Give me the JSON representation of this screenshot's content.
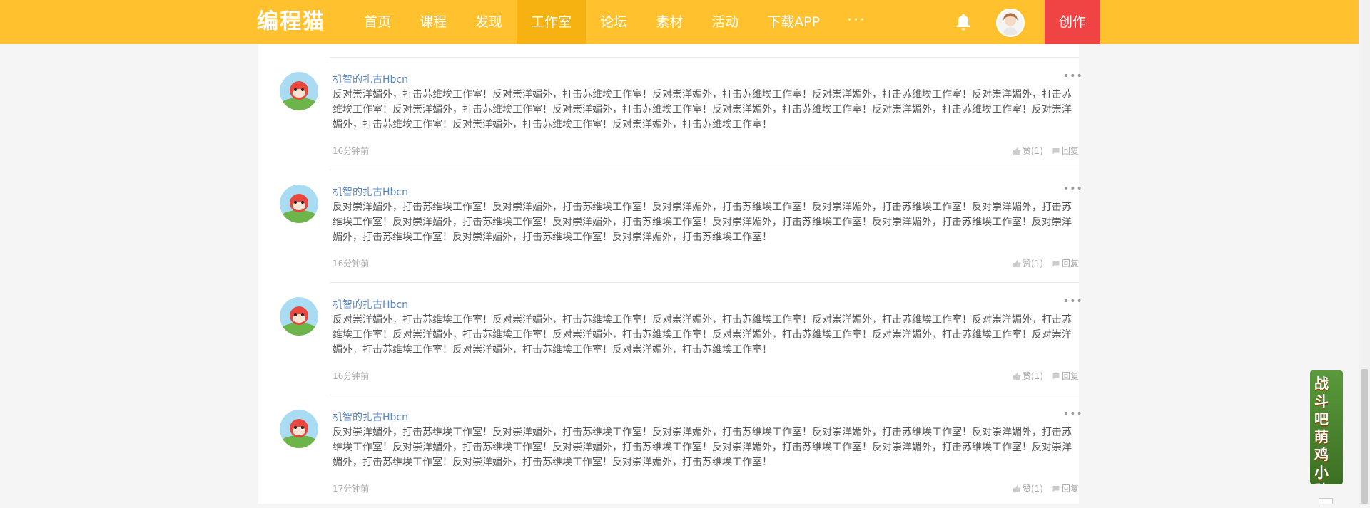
{
  "header": {
    "logo": "编程猫",
    "nav": [
      {
        "label": "首页",
        "active": false
      },
      {
        "label": "课程",
        "active": false
      },
      {
        "label": "发现",
        "active": false
      },
      {
        "label": "工作室",
        "active": true
      },
      {
        "label": "论坛",
        "active": false
      },
      {
        "label": "素材",
        "active": false
      },
      {
        "label": "活动",
        "active": false
      },
      {
        "label": "下载APP",
        "active": false
      }
    ],
    "more": "···",
    "create": "创作",
    "bell_icon": "bell-icon",
    "accent_color": "#ffc22e",
    "create_color": "#ef4443"
  },
  "comments": [
    {
      "user": "机智的扎古Hbcn",
      "text": "反对崇洋媚外，打击苏维埃工作室！反对崇洋媚外，打击苏维埃工作室！反对崇洋媚外，打击苏维埃工作室！反对崇洋媚外，打击苏维埃工作室！反对崇洋媚外，打击苏维埃工作室！反对崇洋媚外，打击苏维埃工作室！反对崇洋媚外，打击苏维埃工作室！反对崇洋媚外，打击苏维埃工作室！反对崇洋媚外，打击苏维埃工作室！反对崇洋媚外，打击苏维埃工作室！反对崇洋媚外，打击苏维埃工作室！反对崇洋媚外，打击苏维埃工作室！",
      "time": "16分钟前",
      "like": "赞(1)",
      "reply": "回复"
    },
    {
      "user": "机智的扎古Hbcn",
      "text": "反对崇洋媚外，打击苏维埃工作室！反对崇洋媚外，打击苏维埃工作室！反对崇洋媚外，打击苏维埃工作室！反对崇洋媚外，打击苏维埃工作室！反对崇洋媚外，打击苏维埃工作室！反对崇洋媚外，打击苏维埃工作室！反对崇洋媚外，打击苏维埃工作室！反对崇洋媚外，打击苏维埃工作室！反对崇洋媚外，打击苏维埃工作室！反对崇洋媚外，打击苏维埃工作室！反对崇洋媚外，打击苏维埃工作室！反对崇洋媚外，打击苏维埃工作室！",
      "time": "16分钟前",
      "like": "赞(1)",
      "reply": "回复"
    },
    {
      "user": "机智的扎古Hbcn",
      "text": "反对崇洋媚外，打击苏维埃工作室！反对崇洋媚外，打击苏维埃工作室！反对崇洋媚外，打击苏维埃工作室！反对崇洋媚外，打击苏维埃工作室！反对崇洋媚外，打击苏维埃工作室！反对崇洋媚外，打击苏维埃工作室！反对崇洋媚外，打击苏维埃工作室！反对崇洋媚外，打击苏维埃工作室！反对崇洋媚外，打击苏维埃工作室！反对崇洋媚外，打击苏维埃工作室！反对崇洋媚外，打击苏维埃工作室！反对崇洋媚外，打击苏维埃工作室！",
      "time": "16分钟前",
      "like": "赞(1)",
      "reply": "回复"
    },
    {
      "user": "机智的扎古Hbcn",
      "text": "反对崇洋媚外，打击苏维埃工作室！反对崇洋媚外，打击苏维埃工作室！反对崇洋媚外，打击苏维埃工作室！反对崇洋媚外，打击苏维埃工作室！反对崇洋媚外，打击苏维埃工作室！反对崇洋媚外，打击苏维埃工作室！反对崇洋媚外，打击苏维埃工作室！反对崇洋媚外，打击苏维埃工作室！反对崇洋媚外，打击苏维埃工作室！反对崇洋媚外，打击苏维埃工作室！反对崇洋媚外，打击苏维埃工作室！反对崇洋媚外，打击苏维埃工作室！",
      "time": "17分钟前",
      "like": "赞(1)",
      "reply": "回复"
    }
  ],
  "banner": {
    "text": "战斗吧萌鸡小队"
  }
}
